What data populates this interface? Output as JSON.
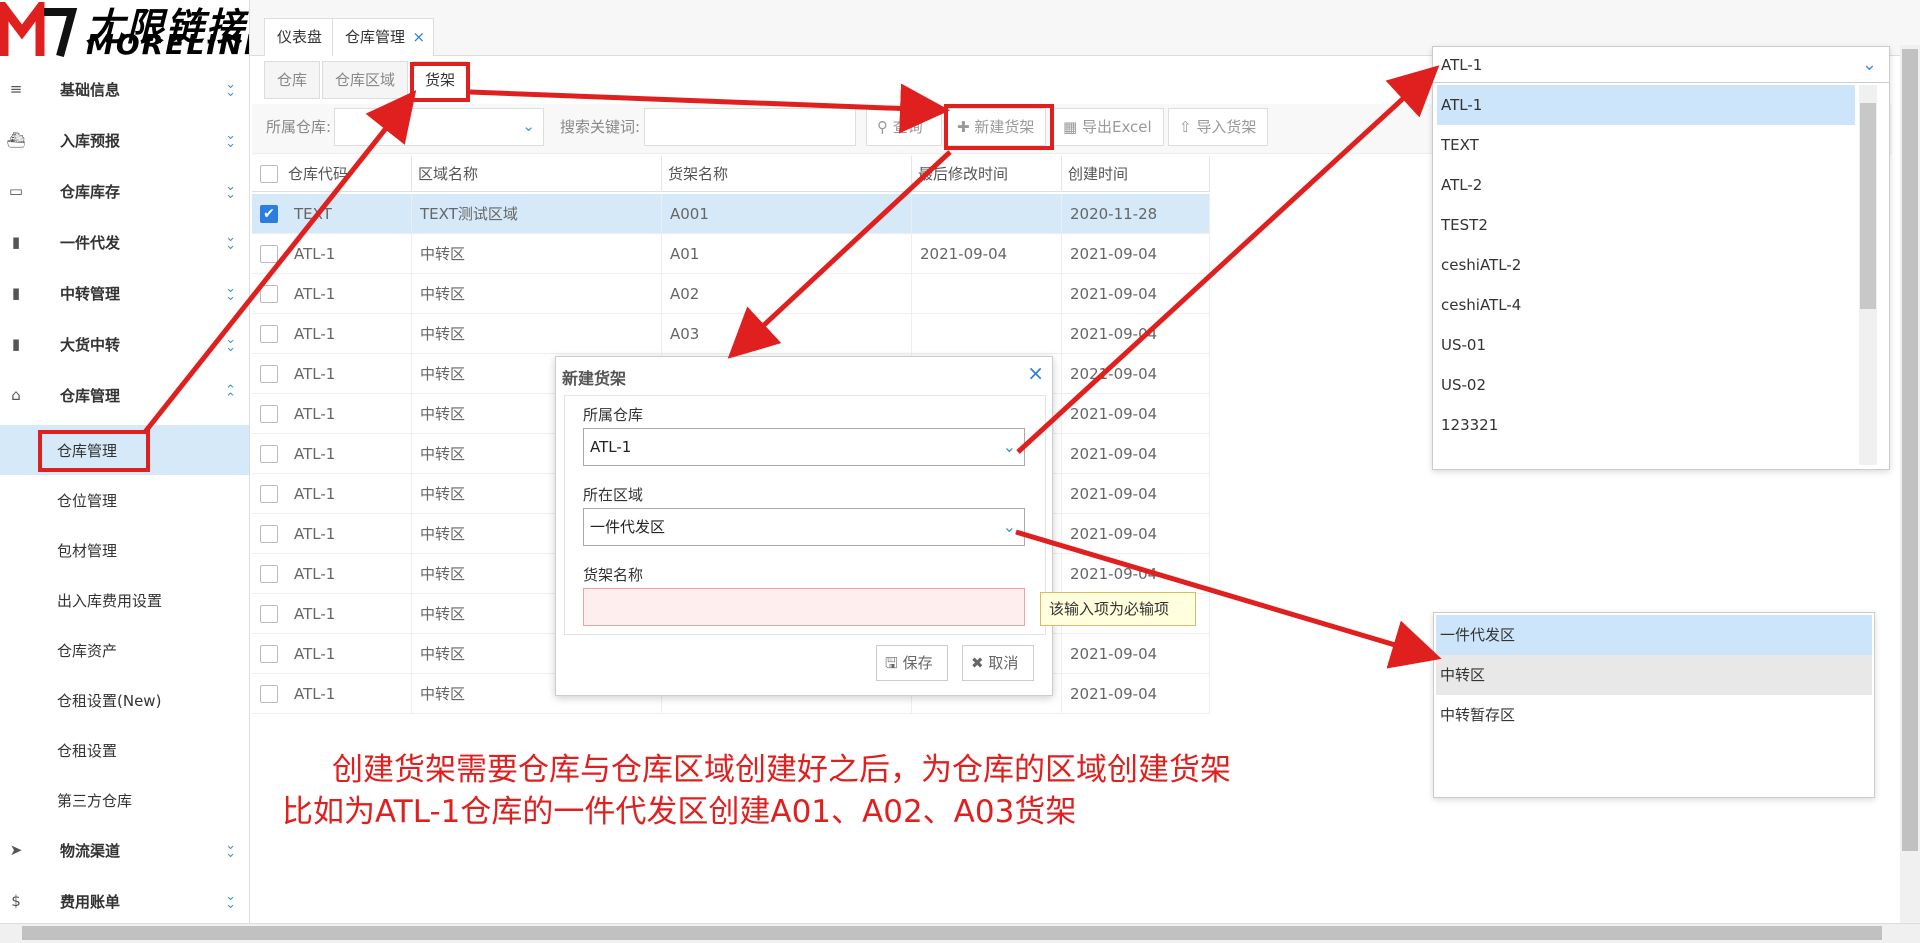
{
  "brand": {
    "cn": "尢限链接",
    "en": "MORELINK"
  },
  "sidebar": {
    "menus": [
      {
        "label": "基础信息",
        "icon": "list-icon"
      },
      {
        "label": "入库预报",
        "icon": "ship-icon"
      },
      {
        "label": "仓库库存",
        "icon": "inbox-icon"
      },
      {
        "label": "一件代发",
        "icon": "truck-icon"
      },
      {
        "label": "中转管理",
        "icon": "truck-icon"
      },
      {
        "label": "大货中转",
        "icon": "truck-icon"
      },
      {
        "label": "仓库管理",
        "icon": "home-icon"
      }
    ],
    "subs": [
      "仓库管理",
      "仓位管理",
      "包材管理",
      "出入库费用设置",
      "仓库资产",
      "仓租设置(New)",
      "仓租设置",
      "第三方仓库"
    ],
    "bottom": [
      {
        "label": "物流渠道",
        "icon": "cursor-icon"
      },
      {
        "label": "费用账单",
        "icon": "dollar-icon"
      }
    ]
  },
  "tabs": {
    "dashboard": "仪表盘",
    "warehouse": "仓库管理",
    "close": "×"
  },
  "subtabs": [
    "仓库",
    "仓库区域",
    "货架"
  ],
  "filters": {
    "warehouse_label": "所属仓库:",
    "keyword_label": "搜索关键词:"
  },
  "toolbar": {
    "query": "查询",
    "new_shelf": "新建货架",
    "export": "导出Excel",
    "import": "导入货架"
  },
  "grid": {
    "headers": [
      "仓库代码",
      "区域名称",
      "货架名称",
      "最后修改时间",
      "创建时间"
    ],
    "rows": [
      [
        "TEXT",
        "TEXT测试区域",
        "A001",
        "",
        "2020-11-28"
      ],
      [
        "ATL-1",
        "中转区",
        "A01",
        "2021-09-04",
        "2021-09-04"
      ],
      [
        "ATL-1",
        "中转区",
        "A02",
        "",
        "2021-09-04"
      ],
      [
        "ATL-1",
        "中转区",
        "A03",
        "",
        "2021-09-04"
      ],
      [
        "ATL-1",
        "中转区",
        "",
        "",
        "2021-09-04"
      ],
      [
        "ATL-1",
        "中转区",
        "",
        "",
        "2021-09-04"
      ],
      [
        "ATL-1",
        "中转区",
        "",
        "",
        "2021-09-04"
      ],
      [
        "ATL-1",
        "中转区",
        "",
        "",
        "2021-09-04"
      ],
      [
        "ATL-1",
        "中转区",
        "",
        "",
        "2021-09-04"
      ],
      [
        "ATL-1",
        "中转区",
        "",
        "",
        "2021-09-04"
      ],
      [
        "ATL-1",
        "中转区",
        "",
        "",
        "2021-09-04"
      ],
      [
        "ATL-1",
        "中转区",
        "",
        "",
        "2021-09-04"
      ],
      [
        "ATL-1",
        "中转区",
        "",
        "",
        "2021-09-04"
      ]
    ]
  },
  "dialog": {
    "title": "新建货架",
    "close": "×",
    "warehouse_label": "所属仓库",
    "warehouse_value": "ATL-1",
    "area_label": "所在区域",
    "area_value": "一件代发区",
    "shelf_label": "货架名称",
    "shelf_value": "",
    "required_tip": "该输入项为必输项",
    "save": "保存",
    "cancel": "取消"
  },
  "warehouse_dropdown": {
    "selected": "ATL-1",
    "options": [
      "ATL-1",
      "TEXT",
      "ATL-2",
      "TEST2",
      "ceshiATL-2",
      "ceshiATL-4",
      "US-01",
      "US-02",
      "123321"
    ]
  },
  "area_dropdown": {
    "options": [
      "一件代发区",
      "中转区",
      "中转暂存区"
    ]
  },
  "annotation": {
    "line1": "创建货架需要仓库与仓库区域创建好之后，为仓库的区域创建货架",
    "line2": "比如为ATL-1仓库的一件代发区创建A01、A02、A03货架"
  },
  "colors": {
    "annotation_red": "#e0201f",
    "selected_row": "#d6e9f8",
    "accent": "#4a90e2"
  }
}
